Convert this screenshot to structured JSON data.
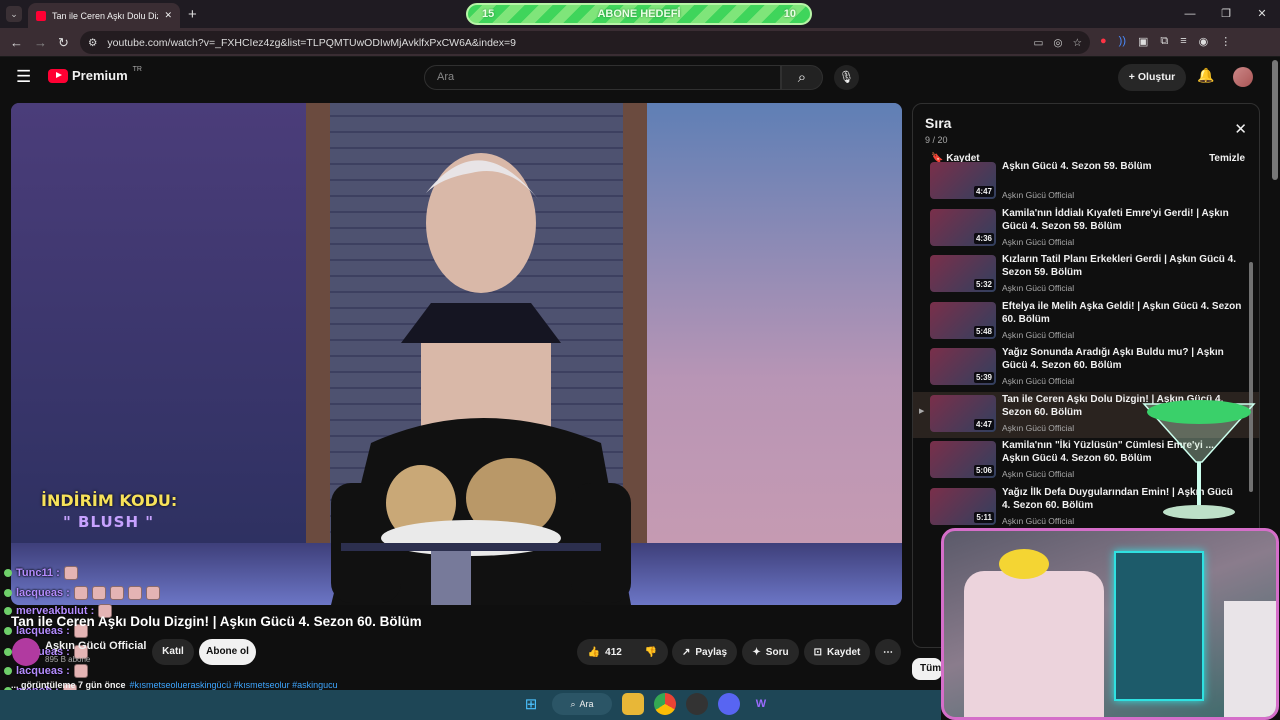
{
  "browser": {
    "tab_title": "Tan ile Ceren Aşkı Dolu Dizgin! | Aşkın Gücü 4. Sezon 60. Bölüm",
    "url": "youtube.com/watch?v=_FXHCIez4zg&list=TLPQMTUwODIwMjAvklfxPxCW6A&index=9",
    "new_tab": "+"
  },
  "goal_bar": {
    "left": "15",
    "label": "ABONE HEDEFİ",
    "right": "10"
  },
  "youtube": {
    "logo": "Premium",
    "region": "TR",
    "search_placeholder": "Ara",
    "create_label": "Oluştur"
  },
  "video": {
    "promo_line1": "İNDİRİM KODU:",
    "promo_line2": "\" BLUSH \"",
    "title": "Tan ile Ceren Aşkı Dolu Dizgin! | Aşkın Gücü 4. Sezon 60. Bölüm",
    "channel": "Aşkın Gücü Official",
    "subs": "895 B abone",
    "join": "Katıl",
    "subscribe": "Abone ol",
    "likes": "412",
    "share": "Paylaş",
    "ask": "Soru",
    "save": "Kaydet",
    "desc_meta": "... görüntüleme  7 gün önce",
    "desc_tags": "#kısmetseolueraskingücü #kısmetseolur #askingucu"
  },
  "chat": [
    {
      "user": "Tunc11 :",
      "emotes": 1
    },
    {
      "user": "lacqueas :",
      "emotes": 5
    },
    {
      "user": "merveakbulut :",
      "emotes": 1
    },
    {
      "user": "lacqueas :",
      "emotes": 1
    },
    {
      "user": "lacqueas :",
      "emotes": 1
    },
    {
      "user": "lacqueas :",
      "emotes": 1
    },
    {
      "user": "menob :",
      "emotes": 1
    },
    {
      "user": "lacqueas :",
      "emotes": 1
    }
  ],
  "playlist": {
    "title": "Sıra",
    "count": "9 / 20",
    "save": "Kaydet",
    "clear": "Temizle",
    "items": [
      {
        "title": "Aşkın Gücü 4. Sezon 59. Bölüm",
        "channel": "Aşkın Gücü Official",
        "duration": "4:47"
      },
      {
        "title": "Kamila'nın İddialı Kıyafeti Emre'yi Gerdi! | Aşkın Gücü 4. Sezon 59. Bölüm",
        "channel": "Aşkın Gücü Official",
        "duration": "4:36"
      },
      {
        "title": "Kızların Tatil Planı Erkekleri Gerdi | Aşkın Gücü 4. Sezon 59. Bölüm",
        "channel": "Aşkın Gücü Official",
        "duration": "5:32"
      },
      {
        "title": "Eftelya ile Melih Aşka Geldi! | Aşkın Gücü 4. Sezon 60. Bölüm",
        "channel": "Aşkın Gücü Official",
        "duration": "5:48"
      },
      {
        "title": "Yağız Sonunda Aradığı Aşkı Buldu mu? | Aşkın Gücü 4. Sezon 60. Bölüm",
        "channel": "Aşkın Gücü Official",
        "duration": "5:39"
      },
      {
        "title": "Tan ile Ceren Aşkı Dolu Dizgin! | Aşkın Gücü 4. Sezon 60. Bölüm",
        "channel": "Aşkın Gücü Official",
        "duration": "4:47"
      },
      {
        "title": "Kamila'nın \"İki Yüzlüsün\" Cümlesi Emre'yi ... Aşkın Gücü 4. Sezon 60. Bölüm",
        "channel": "Aşkın Gücü Official",
        "duration": "5:06"
      },
      {
        "title": "Yağız İlk Defa Duygularından Emin! | Aşkın Gücü 4. Sezon 60. Bölüm",
        "channel": "Aşkın Gücü Official",
        "duration": "5:11"
      }
    ],
    "all_chip": "Tüm"
  },
  "taskbar": {
    "search": "Ara"
  }
}
